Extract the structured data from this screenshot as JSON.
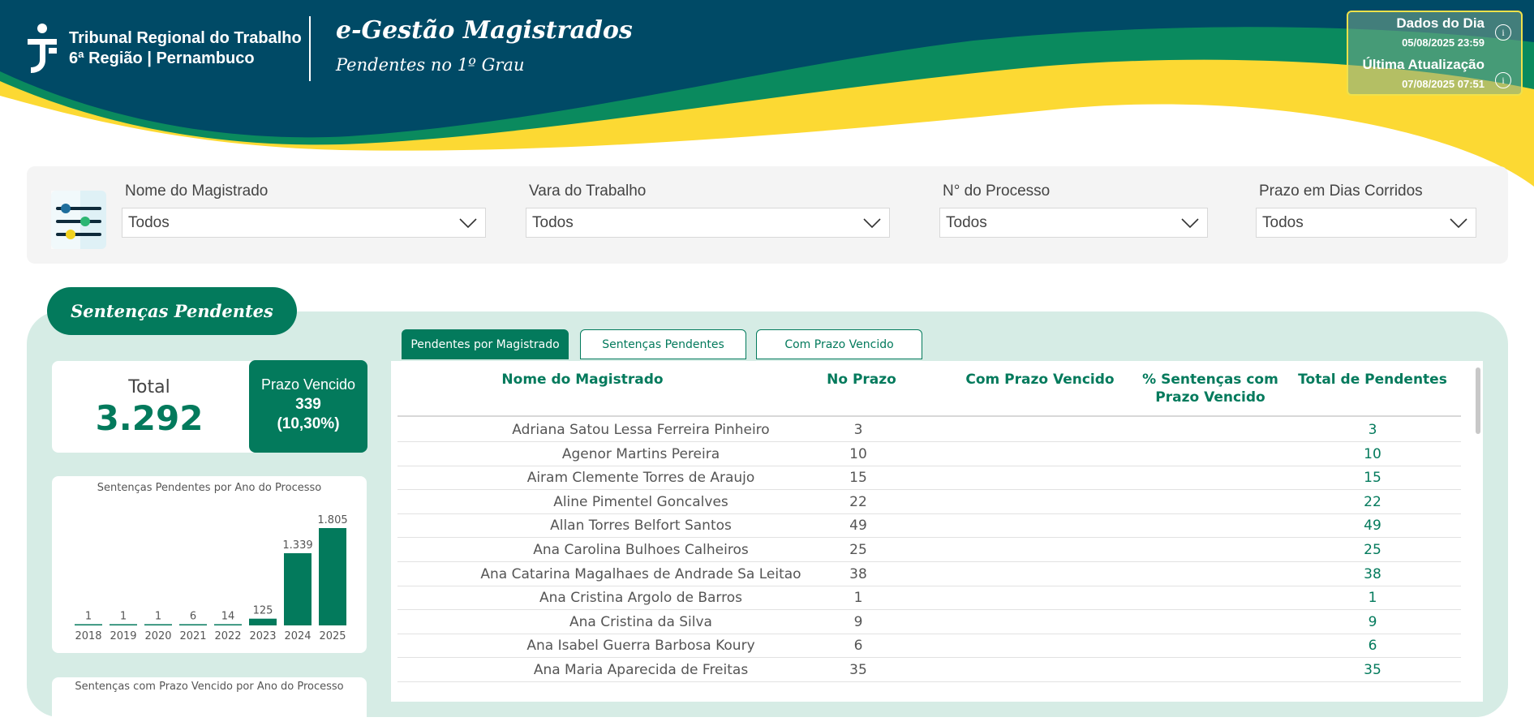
{
  "header": {
    "org_line1": "Tribunal Regional do Trabalho",
    "org_line2": "6ª Região | Pernambuco",
    "app_title": "e-Gestão Magistrados",
    "app_subtitle": "Pendentes no 1º Grau",
    "dados_label": "Dados do Dia",
    "dados_value": "05/08/2025 23:59",
    "atualizacao_label": "Última Atualização",
    "atualizacao_value": "07/08/2025 07:51",
    "colors": {
      "navy": "#004a66",
      "green": "#0a8a5e",
      "yellow": "#fcd933"
    }
  },
  "filters": [
    {
      "label": "Nome do Magistrado",
      "value": "Todos"
    },
    {
      "label": "Vara do Trabalho",
      "value": "Todos"
    },
    {
      "label": "N° do Processo",
      "value": "Todos"
    },
    {
      "label": "Prazo em Dias Corridos",
      "value": "Todos"
    }
  ],
  "section": {
    "title": "Sentenças Pendentes",
    "total_label": "Total",
    "total_value": "3.292",
    "prazo_label": "Prazo Vencido",
    "prazo_value": "339",
    "prazo_pct": "(10,30%)"
  },
  "chart_data": {
    "type": "bar",
    "title": "Sentenças Pendentes por Ano do Processo",
    "categories": [
      "2018",
      "2019",
      "2020",
      "2021",
      "2022",
      "2023",
      "2024",
      "2025"
    ],
    "values": [
      1,
      1,
      1,
      6,
      14,
      125,
      1339,
      1805
    ],
    "labels": [
      "1",
      "1",
      "1",
      "6",
      "14",
      "125",
      "1.339",
      "1.805"
    ],
    "color": "#037a5c"
  },
  "chart2": {
    "title": "Sentenças com Prazo Vencido por Ano do Processo"
  },
  "tabs": [
    {
      "label": "Pendentes por Magistrado",
      "active": true
    },
    {
      "label": "Sentenças Pendentes",
      "active": false
    },
    {
      "label": "Com Prazo Vencido",
      "active": false
    }
  ],
  "table": {
    "columns": [
      "Nome do Magistrado",
      "No Prazo",
      "Com Prazo Vencido",
      "% Sentenças com Prazo Vencido",
      "Total de Pendentes"
    ],
    "rows": [
      [
        "Adriana Satou Lessa Ferreira Pinheiro",
        "3",
        "",
        "",
        "3"
      ],
      [
        "Agenor Martins Pereira",
        "10",
        "",
        "",
        "10"
      ],
      [
        "Airam Clemente Torres de Araujo",
        "15",
        "",
        "",
        "15"
      ],
      [
        "Aline Pimentel Goncalves",
        "22",
        "",
        "",
        "22"
      ],
      [
        "Allan Torres Belfort Santos",
        "49",
        "",
        "",
        "49"
      ],
      [
        "Ana Carolina Bulhoes Calheiros",
        "25",
        "",
        "",
        "25"
      ],
      [
        "Ana Catarina Magalhaes de Andrade Sa Leitao",
        "38",
        "",
        "",
        "38"
      ],
      [
        "Ana Cristina Argolo de Barros",
        "1",
        "",
        "",
        "1"
      ],
      [
        "Ana Cristina da Silva",
        "9",
        "",
        "",
        "9"
      ],
      [
        "Ana Isabel Guerra Barbosa Koury",
        "6",
        "",
        "",
        "6"
      ],
      [
        "Ana Maria Aparecida de Freitas",
        "35",
        "",
        "",
        "35"
      ]
    ]
  }
}
